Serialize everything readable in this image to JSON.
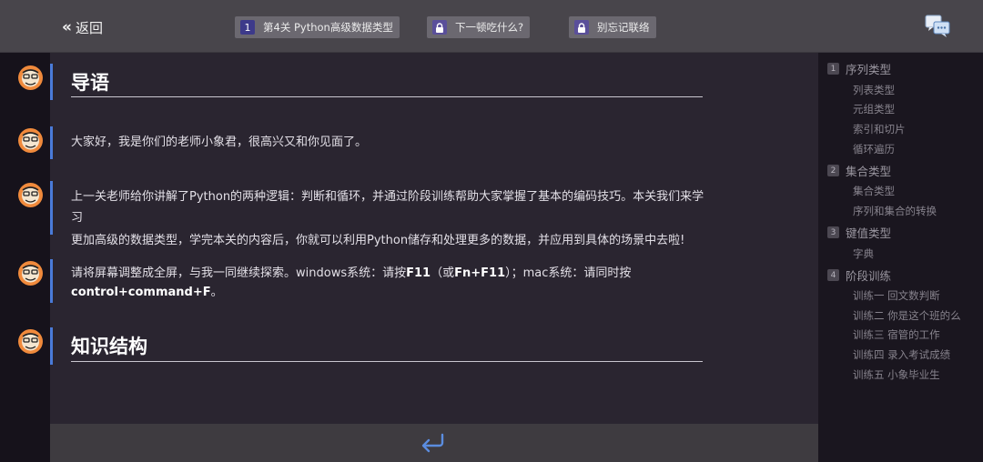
{
  "topbar": {
    "back_label": "返回",
    "chips": [
      {
        "badge": "1",
        "label": "第4关 Python高级数据类型"
      },
      {
        "label": "下一顿吃什么?"
      },
      {
        "label": "别忘记联络"
      }
    ]
  },
  "content": {
    "intro_heading": "导语",
    "greeting": "大家好，我是你们的老师小象君，很高兴又和你见面了。",
    "para2_line1": "上一关老师给你讲解了Python的两种逻辑：判断和循环，并通过阶段训练帮助大家掌握了基本的编码技巧。本关我们来学习",
    "para2_line2": "更加高级的数据类型，学完本关的内容后，你就可以利用Python储存和处理更多的数据，并应用到具体的场景中去啦!",
    "para3_pre": "请将屏幕调整成全屏，与我一同继续探索。windows系统：请按",
    "para3_key1": "F11",
    "para3_mid1": "（或",
    "para3_key2": "Fn+F11",
    "para3_mid2": "）；mac系统：请同时按",
    "para3_key3": "control+command+F",
    "para3_end": "。",
    "structure_heading": "知识结构"
  },
  "sidebar": {
    "sections": [
      {
        "num": "1",
        "label": "序列类型",
        "items": [
          "列表类型",
          "元组类型",
          "索引和切片",
          "循环遍历"
        ]
      },
      {
        "num": "2",
        "label": "集合类型",
        "items": [
          "集合类型",
          "序列和集合的转换"
        ]
      },
      {
        "num": "3",
        "label": "键值类型",
        "items": [
          "字典"
        ]
      },
      {
        "num": "4",
        "label": "阶段训练",
        "items": [
          "训练一 回文数判断",
          "训练二 你是这个班的么",
          "训练三 宿管的工作",
          "训练四 录入考试成绩",
          "训练五 小象毕业生"
        ]
      }
    ]
  },
  "colors": {
    "accent_bar": "#4a7bd8",
    "chip_badge": "#3d3a8a",
    "return_icon": "#5b8de0"
  }
}
